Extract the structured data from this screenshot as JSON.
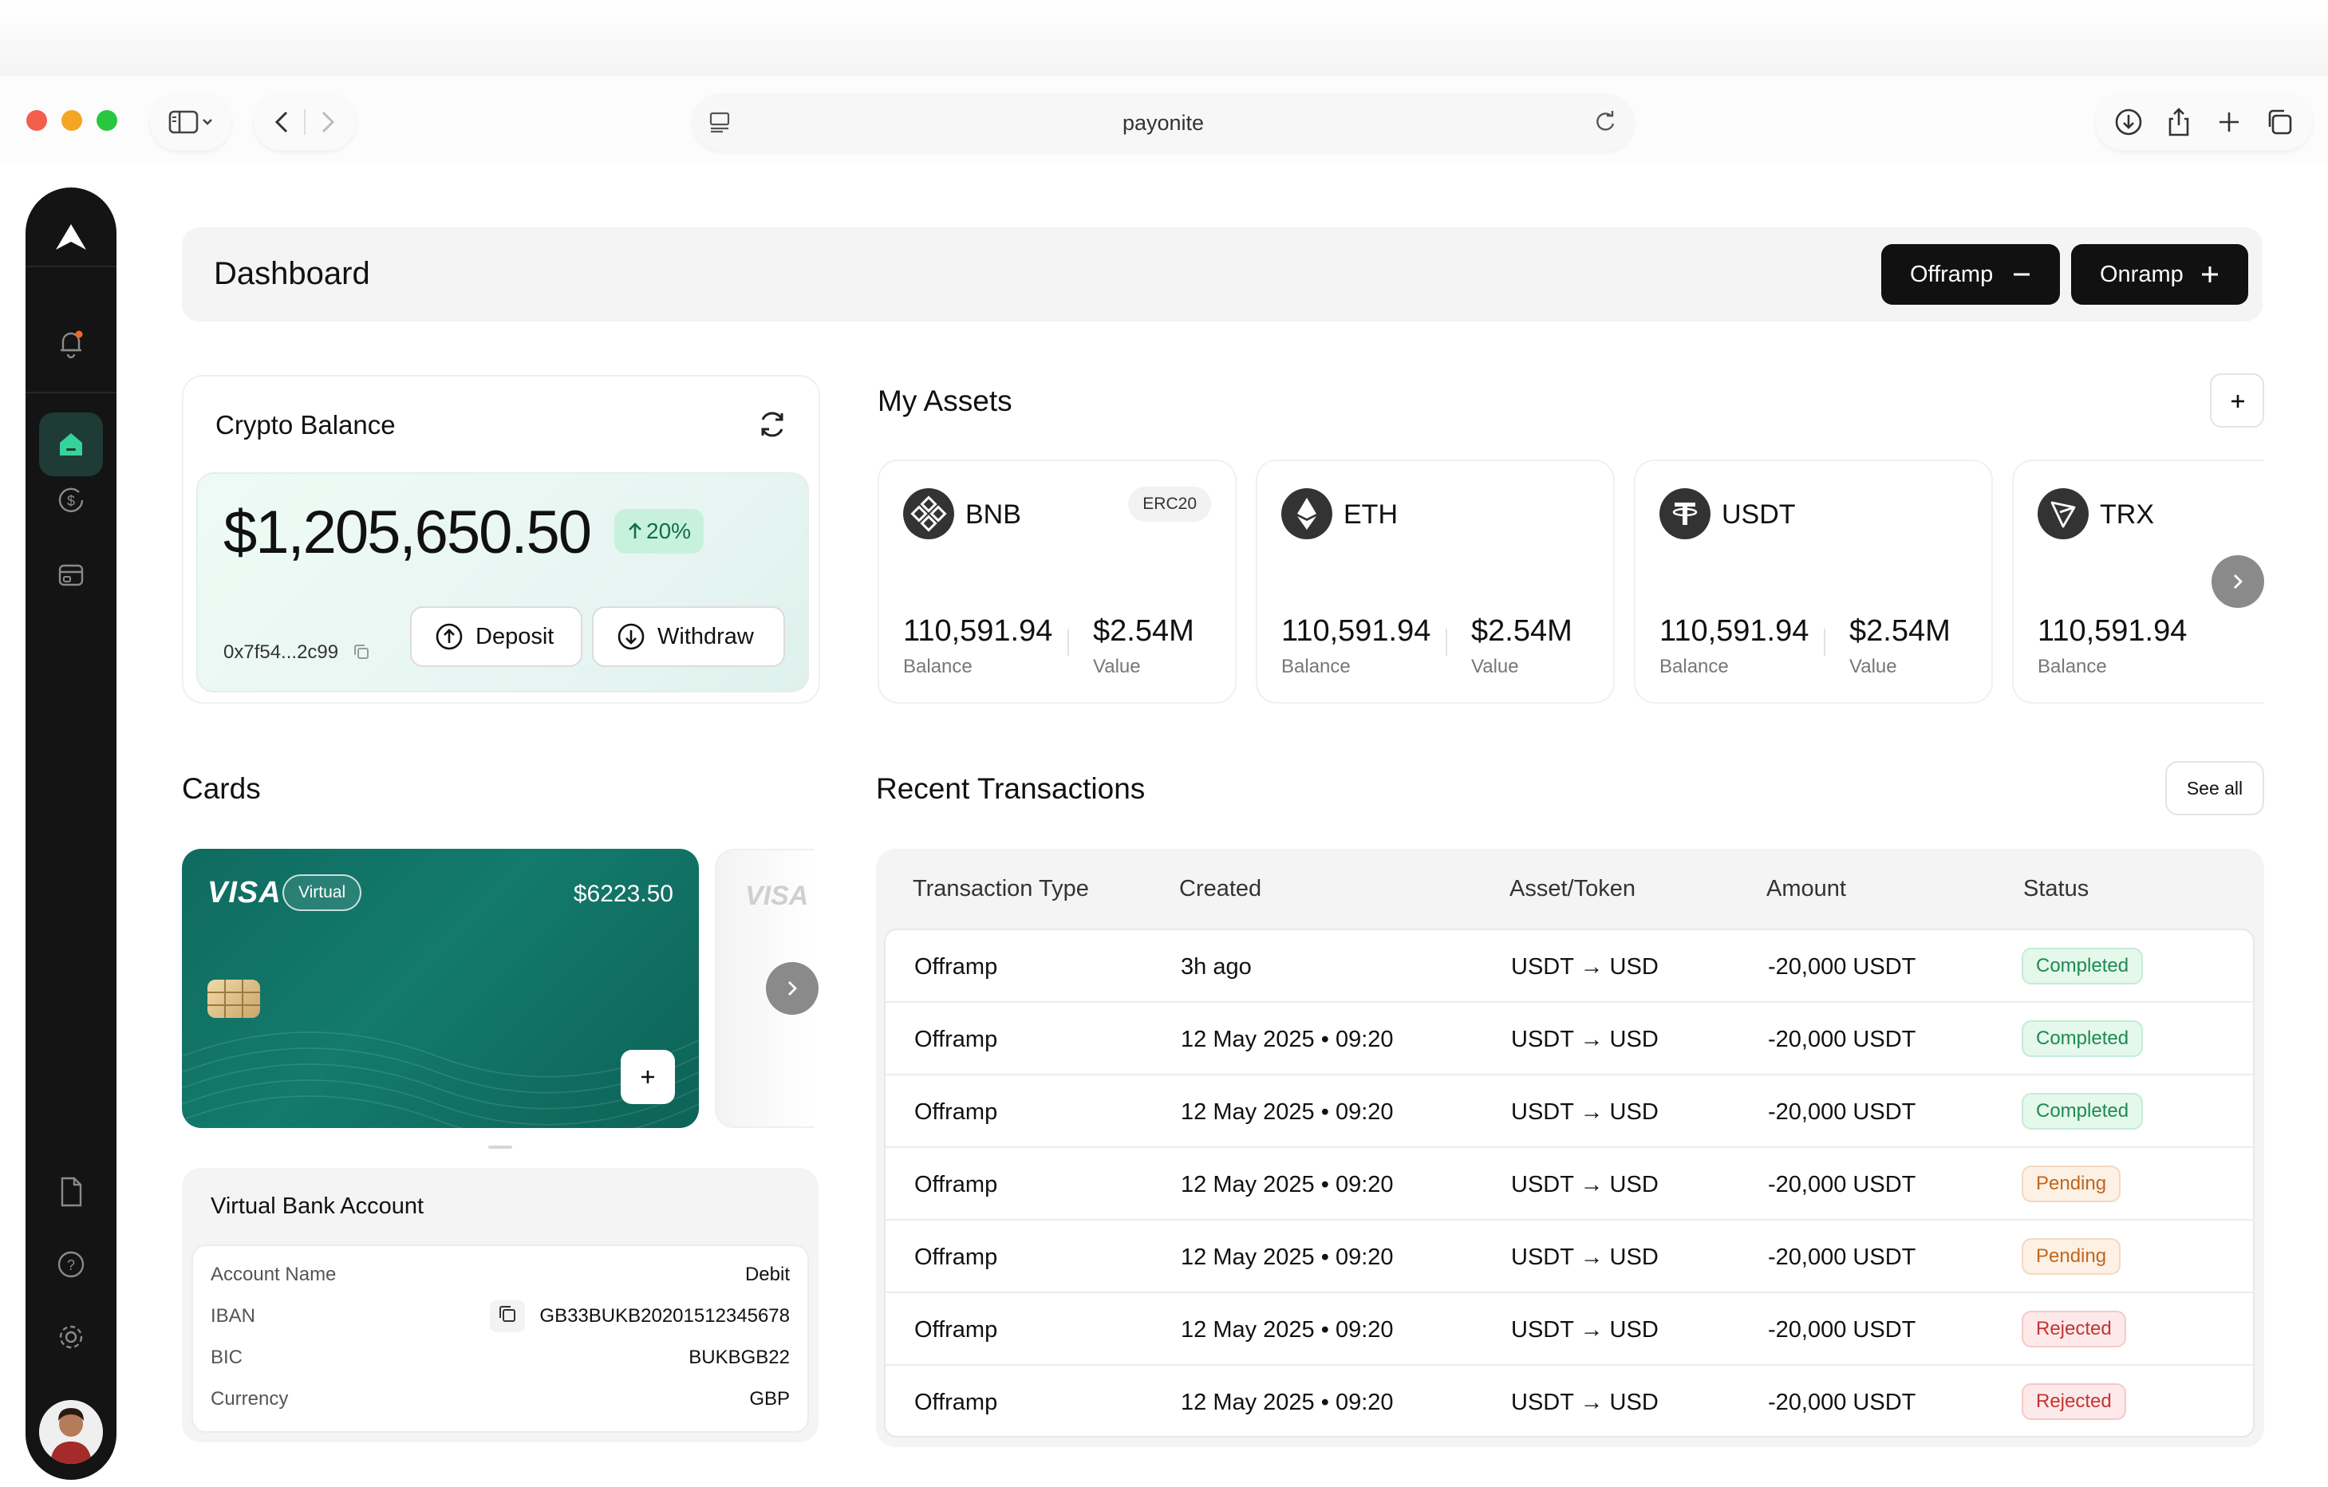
{
  "browser": {
    "url": "payonite",
    "traffic_colors": [
      "#f25f4c",
      "#f5a524",
      "#27c840"
    ]
  },
  "header": {
    "title": "Dashboard",
    "offramp_label": "Offramp",
    "onramp_label": "Onramp"
  },
  "crypto_balance": {
    "title": "Crypto Balance",
    "amount": "$1,205,650.50",
    "change": "20%",
    "address": "0x7f54...2c99",
    "deposit_label": "Deposit",
    "withdraw_label": "Withdraw"
  },
  "assets": {
    "title": "My Assets",
    "items": [
      {
        "name": "BNB",
        "tag": "ERC20",
        "balance": "110,591.94",
        "balance_label": "Balance",
        "value": "$2.54M",
        "value_label": "Value",
        "icon": "bnb-icon"
      },
      {
        "name": "ETH",
        "tag": "",
        "balance": "110,591.94",
        "balance_label": "Balance",
        "value": "$2.54M",
        "value_label": "Value",
        "icon": "eth-icon"
      },
      {
        "name": "USDT",
        "tag": "",
        "balance": "110,591.94",
        "balance_label": "Balance",
        "value": "$2.54M",
        "value_label": "Value",
        "icon": "usdt-icon"
      },
      {
        "name": "TRX",
        "tag": "",
        "balance": "110,591.94",
        "balance_label": "Balance",
        "value": "",
        "value_label": "",
        "icon": "trx-icon"
      }
    ]
  },
  "cards": {
    "title": "Cards",
    "brand": "VISA",
    "badge": "Virtual",
    "balance": "$6223.50",
    "ghost_brand": "VISA"
  },
  "bank": {
    "title": "Virtual Bank Account",
    "rows": [
      {
        "key": "Account Name",
        "value": "Debit"
      },
      {
        "key": "IBAN",
        "value": "GB33BUKB20201512345678"
      },
      {
        "key": "BIC",
        "value": "BUKBGB22"
      },
      {
        "key": "Currency",
        "value": "GBP"
      }
    ]
  },
  "transactions": {
    "title": "Recent Transactions",
    "see_all": "See all",
    "columns": [
      "Transaction Type",
      "Created",
      "Asset/Token",
      "Amount",
      "Status"
    ],
    "rows": [
      {
        "type": "Offramp",
        "created": "3h ago",
        "asset": "USDT → USD",
        "amount": "-20,000 USDT",
        "status": "Completed"
      },
      {
        "type": "Offramp",
        "created": "12 May 2025 • 09:20",
        "asset": "USDT → USD",
        "amount": "-20,000 USDT",
        "status": "Completed"
      },
      {
        "type": "Offramp",
        "created": "12 May 2025 • 09:20",
        "asset": "USDT → USD",
        "amount": "-20,000 USDT",
        "status": "Completed"
      },
      {
        "type": "Offramp",
        "created": "12 May 2025 • 09:20",
        "asset": "USDT → USD",
        "amount": "-20,000 USDT",
        "status": "Pending"
      },
      {
        "type": "Offramp",
        "created": "12 May 2025 • 09:20",
        "asset": "USDT → USD",
        "amount": "-20,000 USDT",
        "status": "Pending"
      },
      {
        "type": "Offramp",
        "created": "12 May 2025 • 09:20",
        "asset": "USDT → USD",
        "amount": "-20,000 USDT",
        "status": "Rejected"
      },
      {
        "type": "Offramp",
        "created": "12 May 2025 • 09:20",
        "asset": "USDT → USD",
        "amount": "-20,000 USDT",
        "status": "Rejected"
      }
    ]
  },
  "colors": {
    "accent": "#137a6c",
    "completed": "#1f8a50",
    "pending": "#c2661d",
    "rejected": "#c33434"
  }
}
